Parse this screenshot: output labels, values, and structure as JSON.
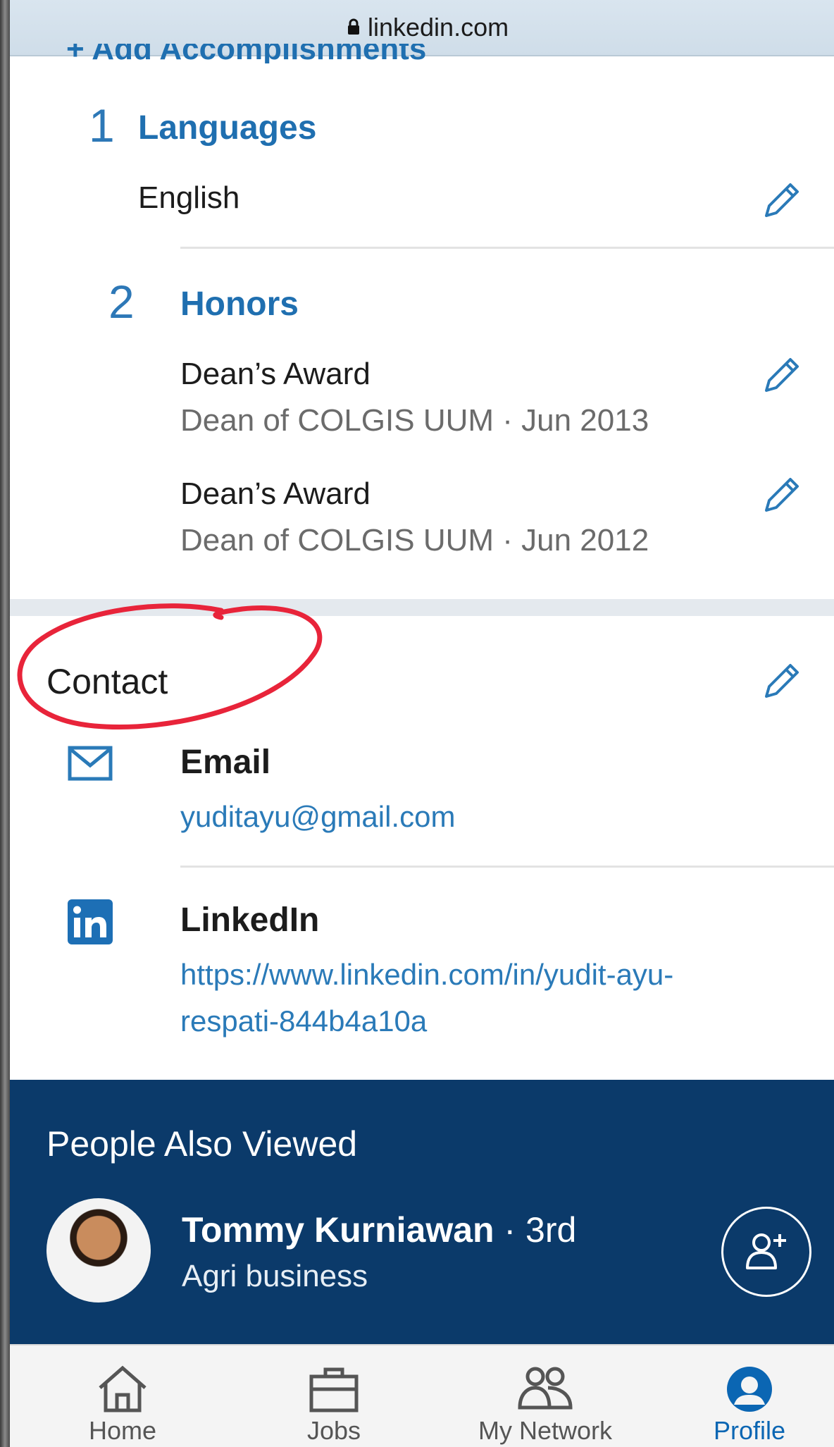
{
  "browser": {
    "url": "linkedin.com"
  },
  "cut_heading": "+ Add Accomplishments",
  "sections": {
    "languages": {
      "number": "1",
      "title": "Languages",
      "items": [
        {
          "title": "English"
        }
      ]
    },
    "honors": {
      "number": "2",
      "title": "Honors",
      "items": [
        {
          "title": "Dean’s Award",
          "subtitle": "Dean of COLGIS UUM · Jun 2013"
        },
        {
          "title": "Dean’s Award",
          "subtitle": "Dean of COLGIS UUM · Jun 2012"
        }
      ]
    }
  },
  "contact": {
    "title": "Contact",
    "email": {
      "label": "Email",
      "value": "yuditayu@gmail.com"
    },
    "linkedin": {
      "label": "LinkedIn",
      "line1": "https://www.linkedin.com/in/yudit-ayu-",
      "line2": "respati-844b4a10a"
    }
  },
  "people_also_viewed": {
    "title": "People Also Viewed",
    "person": {
      "name": "Tommy Kurniawan",
      "degree": " · 3rd",
      "headline": "Agri business"
    }
  },
  "tabs": [
    {
      "label": "Home",
      "icon": "home-icon"
    },
    {
      "label": "Jobs",
      "icon": "briefcase-icon"
    },
    {
      "label": "My Network",
      "icon": "network-icon"
    },
    {
      "label": "Profile",
      "icon": "profile-icon"
    }
  ],
  "colors": {
    "accent": "#1f6fb0",
    "link": "#2a7ab8",
    "dark_band": "#0b3a6a",
    "annotation": "#e8243a"
  }
}
